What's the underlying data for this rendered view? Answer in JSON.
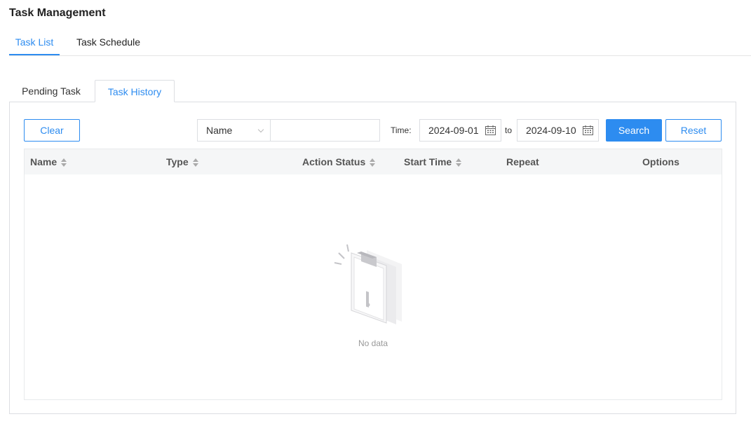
{
  "page": {
    "title": "Task Management"
  },
  "top_tabs": [
    {
      "label": "Task List",
      "active": true
    },
    {
      "label": "Task Schedule",
      "active": false
    }
  ],
  "sub_tabs": [
    {
      "label": "Pending Task",
      "active": false
    },
    {
      "label": "Task History",
      "active": true
    }
  ],
  "toolbar": {
    "clear_label": "Clear",
    "filter_field": "Name",
    "filter_value": "",
    "time_label": "Time:",
    "start_date": "2024-09-01",
    "to_label": "to",
    "end_date": "2024-09-10",
    "search_label": "Search",
    "reset_label": "Reset"
  },
  "table": {
    "columns": [
      {
        "label": "Name",
        "sortable": true
      },
      {
        "label": "Type",
        "sortable": true
      },
      {
        "label": "Action Status",
        "sortable": true
      },
      {
        "label": "Start Time",
        "sortable": true
      },
      {
        "label": "Repeat",
        "sortable": false
      },
      {
        "label": "Options",
        "sortable": false
      }
    ],
    "rows": [],
    "empty_text": "No data"
  },
  "colors": {
    "accent": "#2d8cf0",
    "border": "#dcdee2",
    "header_bg": "#f5f6f7"
  },
  "icons": {
    "date_picker": "calendar-icon",
    "select": "chevron-down-icon",
    "sort": "sort-icon",
    "empty": "empty-data-illustration"
  }
}
